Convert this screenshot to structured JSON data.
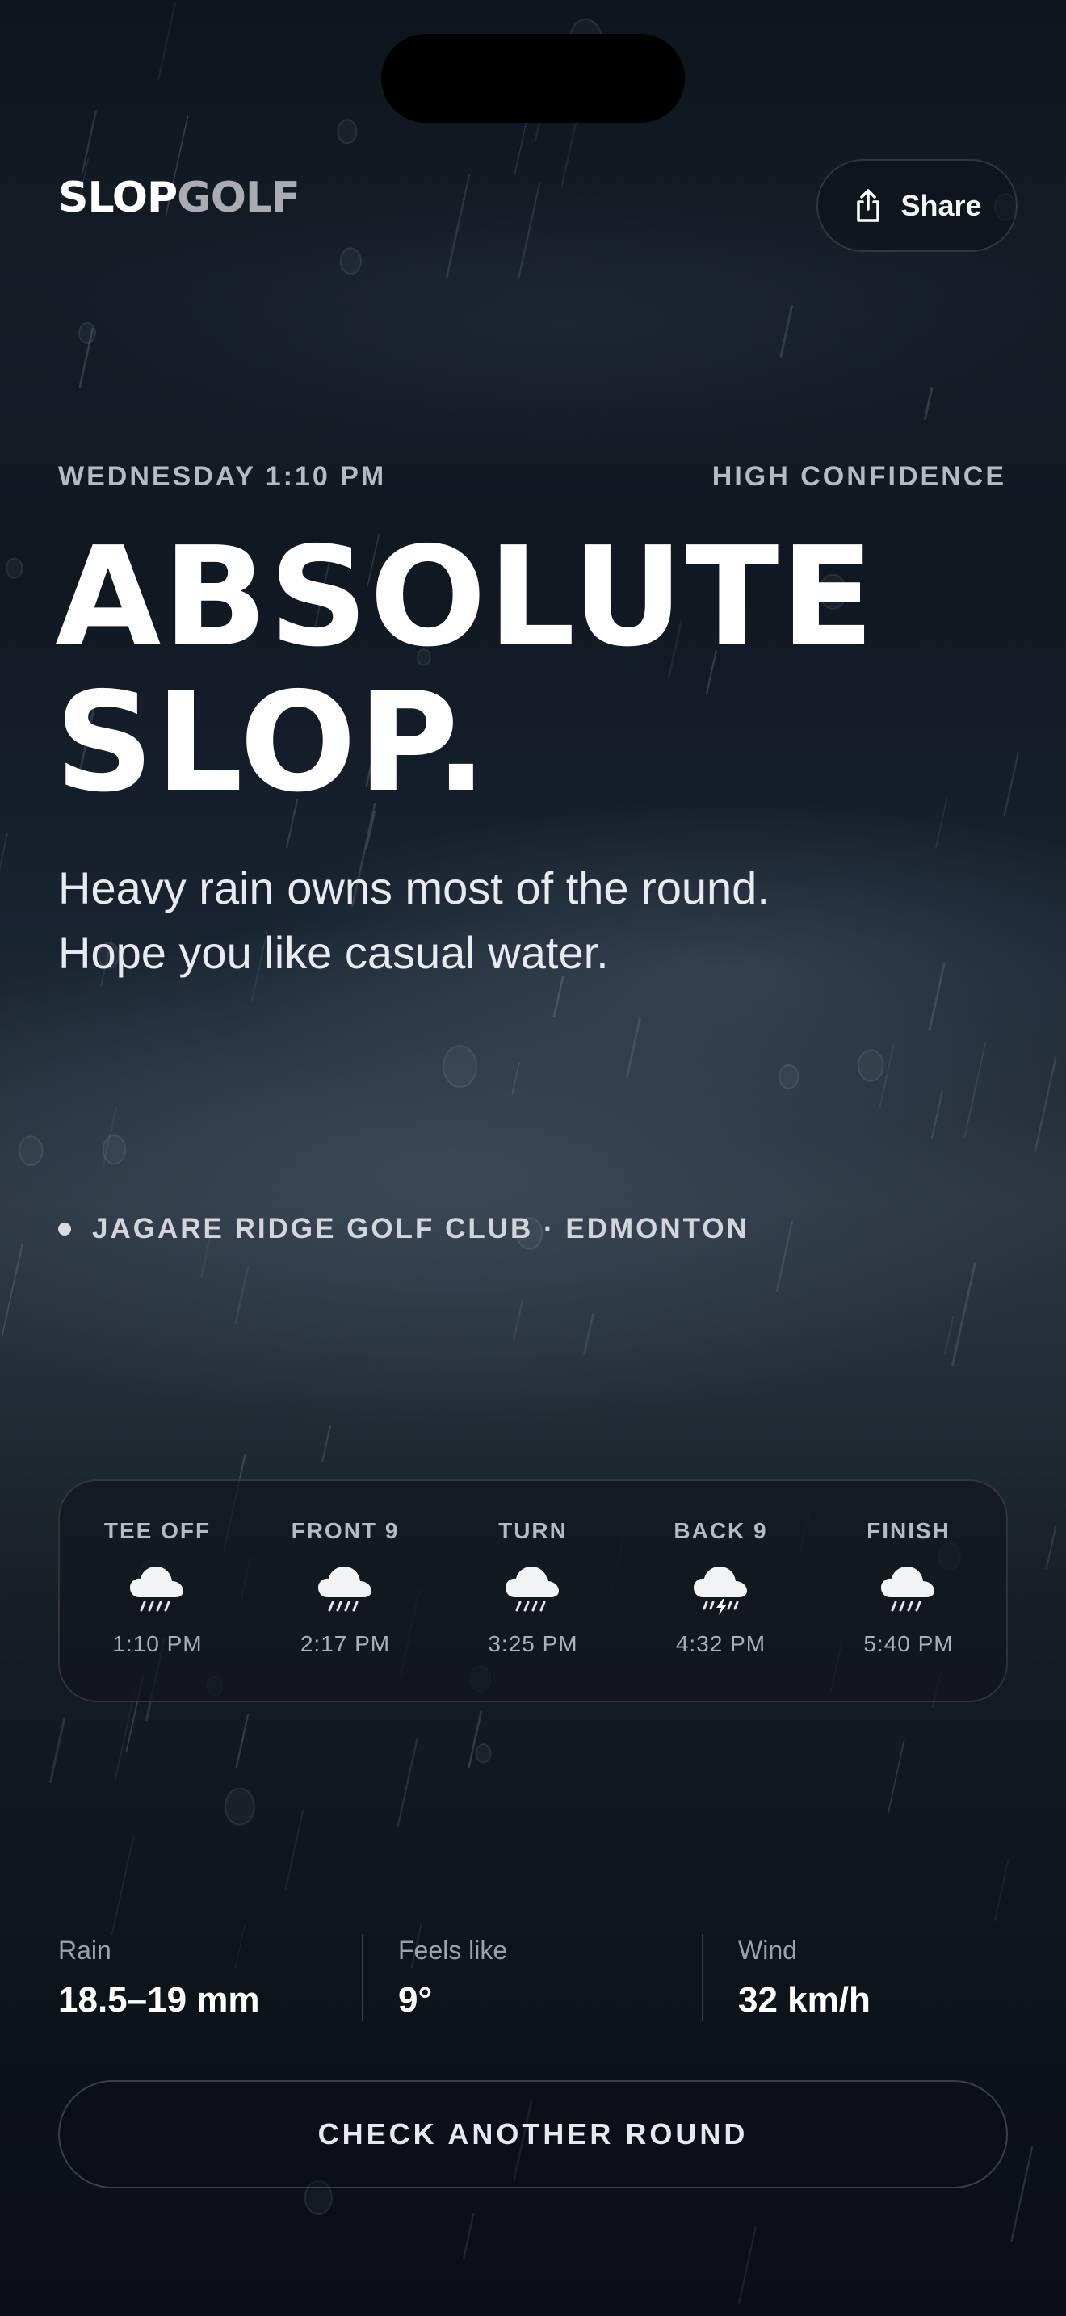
{
  "app": {
    "logo_part1": "SLOP",
    "logo_part2": "GOLF",
    "share_label": "Share"
  },
  "verdict": {
    "day_time": "WEDNESDAY 1:10 PM",
    "confidence": "HIGH CONFIDENCE",
    "headline_line1": "ABSOLUTE",
    "headline_line2": "SLOP.",
    "subtext_line1": "Heavy rain owns most of the round.",
    "subtext_line2": "Hope you like casual water."
  },
  "location": {
    "text": "JAGARE RIDGE GOLF CLUB · EDMONTON"
  },
  "timeline": [
    {
      "label": "TEE OFF",
      "time": "1:10 PM",
      "icon": "rain-icon"
    },
    {
      "label": "FRONT 9",
      "time": "2:17 PM",
      "icon": "rain-icon"
    },
    {
      "label": "TURN",
      "time": "3:25 PM",
      "icon": "rain-icon"
    },
    {
      "label": "BACK 9",
      "time": "4:32 PM",
      "icon": "thunderstorm-icon"
    },
    {
      "label": "FINISH",
      "time": "5:40 PM",
      "icon": "rain-icon"
    }
  ],
  "stats": {
    "rain_label": "Rain",
    "rain_value": "18.5–19 mm",
    "feels_label": "Feels like",
    "feels_value": "9°",
    "wind_label": "Wind",
    "wind_value": "32 km/h"
  },
  "cta_label": "CHECK ANOTHER ROUND",
  "colors": {
    "background_top": "#0d141c",
    "background_mid": "#2a3540",
    "background_bottom": "#0a0f15",
    "text_primary": "#ffffff",
    "text_muted": "#b5bbc2",
    "logo_secondary": "#a9adb2"
  }
}
